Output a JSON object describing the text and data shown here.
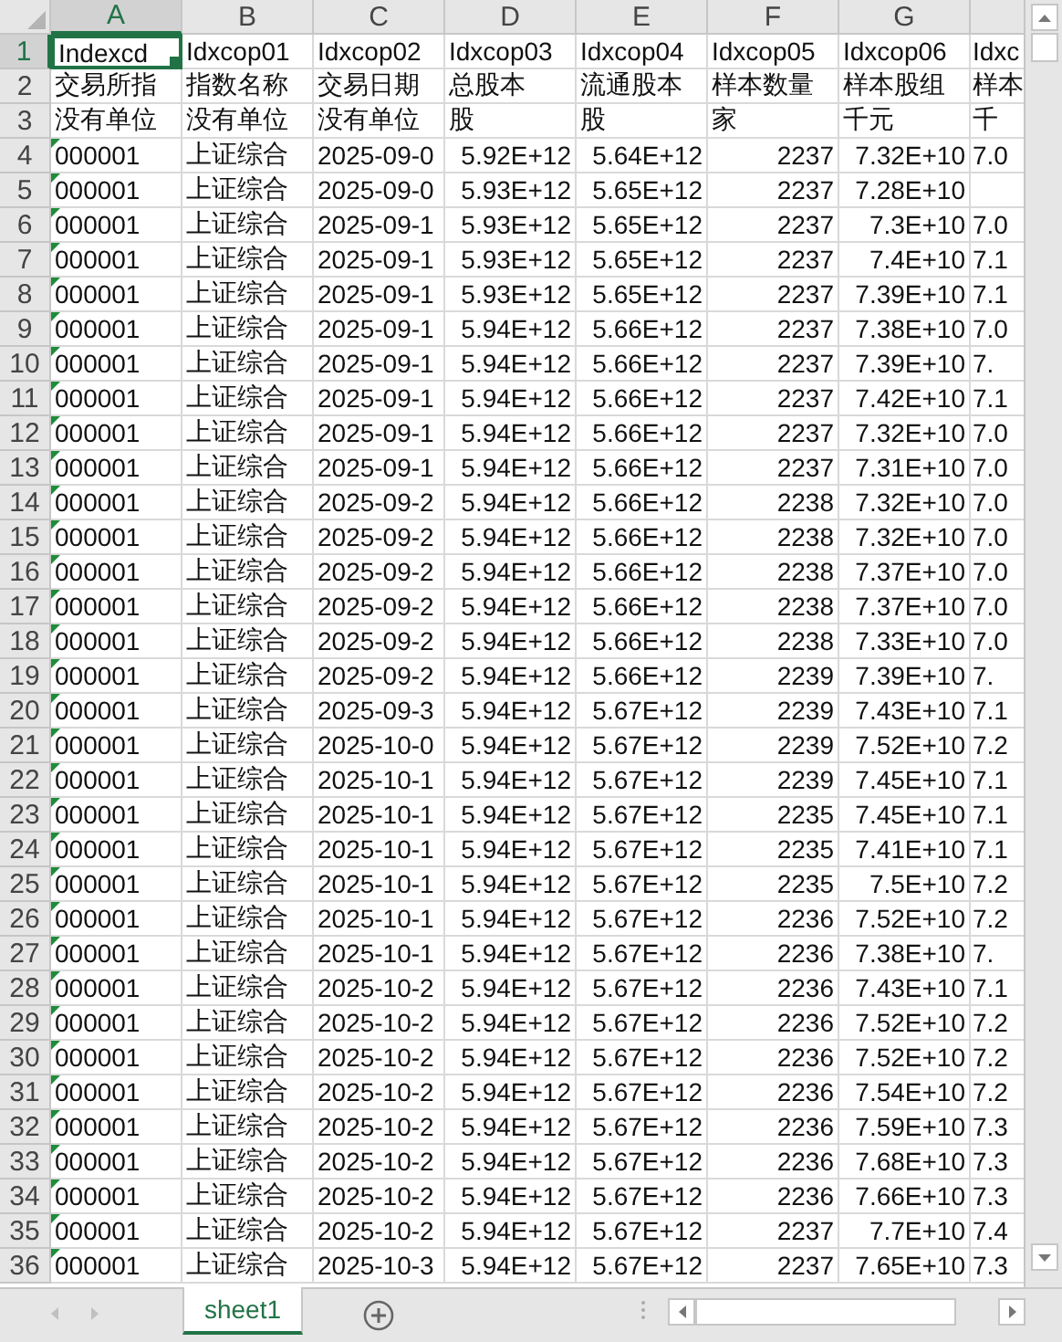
{
  "columns": [
    {
      "letter": "A",
      "kind": "code",
      "selected": true
    },
    {
      "letter": "B",
      "kind": "text",
      "selected": false
    },
    {
      "letter": "C",
      "kind": "text",
      "selected": false
    },
    {
      "letter": "D",
      "kind": "number",
      "selected": false
    },
    {
      "letter": "E",
      "kind": "number",
      "selected": false
    },
    {
      "letter": "F",
      "kind": "number",
      "selected": false
    },
    {
      "letter": "G",
      "kind": "number",
      "selected": false
    },
    {
      "kind": "partial",
      "selected": false
    }
  ],
  "rows": [
    {
      "number": "1",
      "kind": "header",
      "selected": true,
      "cells": [
        "Indexcd",
        "Idxcop01",
        "Idxcop02",
        "Idxcop03",
        "Idxcop04",
        "Idxcop05",
        "Idxcop06",
        "Idxc"
      ]
    },
    {
      "number": "2",
      "kind": "header",
      "selected": false,
      "cells": [
        "交易所指",
        "指数名称",
        "交易日期",
        "总股本",
        "流通股本",
        "样本数量",
        "样本股组",
        "样本"
      ]
    },
    {
      "number": "3",
      "kind": "header",
      "selected": false,
      "cells": [
        "没有单位",
        "没有单位",
        "没有单位",
        "股",
        "股",
        "家",
        "千元",
        "千"
      ]
    },
    {
      "number": "4",
      "kind": "data",
      "selected": false,
      "cells": [
        "000001",
        "上证综合",
        "2025-09-0",
        "5.92E+12",
        "5.64E+12",
        "2237",
        "7.32E+10",
        "7.0"
      ]
    },
    {
      "number": "5",
      "kind": "data",
      "selected": false,
      "cells": [
        "000001",
        "上证综合",
        "2025-09-0",
        "5.93E+12",
        "5.65E+12",
        "2237",
        "7.28E+10",
        null
      ]
    },
    {
      "number": "6",
      "kind": "data",
      "selected": false,
      "cells": [
        "000001",
        "上证综合",
        "2025-09-1",
        "5.93E+12",
        "5.65E+12",
        "2237",
        "7.3E+10",
        "7.0"
      ]
    },
    {
      "number": "7",
      "kind": "data",
      "selected": false,
      "cells": [
        "000001",
        "上证综合",
        "2025-09-1",
        "5.93E+12",
        "5.65E+12",
        "2237",
        "7.4E+10",
        "7.1"
      ]
    },
    {
      "number": "8",
      "kind": "data",
      "selected": false,
      "cells": [
        "000001",
        "上证综合",
        "2025-09-1",
        "5.93E+12",
        "5.65E+12",
        "2237",
        "7.39E+10",
        "7.1"
      ]
    },
    {
      "number": "9",
      "kind": "data",
      "selected": false,
      "cells": [
        "000001",
        "上证综合",
        "2025-09-1",
        "5.94E+12",
        "5.66E+12",
        "2237",
        "7.38E+10",
        "7.0"
      ]
    },
    {
      "number": "10",
      "kind": "data",
      "selected": false,
      "cells": [
        "000001",
        "上证综合",
        "2025-09-1",
        "5.94E+12",
        "5.66E+12",
        "2237",
        "7.39E+10",
        "7."
      ]
    },
    {
      "number": "11",
      "kind": "data",
      "selected": false,
      "cells": [
        "000001",
        "上证综合",
        "2025-09-1",
        "5.94E+12",
        "5.66E+12",
        "2237",
        "7.42E+10",
        "7.1"
      ]
    },
    {
      "number": "12",
      "kind": "data",
      "selected": false,
      "cells": [
        "000001",
        "上证综合",
        "2025-09-1",
        "5.94E+12",
        "5.66E+12",
        "2237",
        "7.32E+10",
        "7.0"
      ]
    },
    {
      "number": "13",
      "kind": "data",
      "selected": false,
      "cells": [
        "000001",
        "上证综合",
        "2025-09-1",
        "5.94E+12",
        "5.66E+12",
        "2237",
        "7.31E+10",
        "7.0"
      ]
    },
    {
      "number": "14",
      "kind": "data",
      "selected": false,
      "cells": [
        "000001",
        "上证综合",
        "2025-09-2",
        "5.94E+12",
        "5.66E+12",
        "2238",
        "7.32E+10",
        "7.0"
      ]
    },
    {
      "number": "15",
      "kind": "data",
      "selected": false,
      "cells": [
        "000001",
        "上证综合",
        "2025-09-2",
        "5.94E+12",
        "5.66E+12",
        "2238",
        "7.32E+10",
        "7.0"
      ]
    },
    {
      "number": "16",
      "kind": "data",
      "selected": false,
      "cells": [
        "000001",
        "上证综合",
        "2025-09-2",
        "5.94E+12",
        "5.66E+12",
        "2238",
        "7.37E+10",
        "7.0"
      ]
    },
    {
      "number": "17",
      "kind": "data",
      "selected": false,
      "cells": [
        "000001",
        "上证综合",
        "2025-09-2",
        "5.94E+12",
        "5.66E+12",
        "2238",
        "7.37E+10",
        "7.0"
      ]
    },
    {
      "number": "18",
      "kind": "data",
      "selected": false,
      "cells": [
        "000001",
        "上证综合",
        "2025-09-2",
        "5.94E+12",
        "5.66E+12",
        "2238",
        "7.33E+10",
        "7.0"
      ]
    },
    {
      "number": "19",
      "kind": "data",
      "selected": false,
      "cells": [
        "000001",
        "上证综合",
        "2025-09-2",
        "5.94E+12",
        "5.66E+12",
        "2239",
        "7.39E+10",
        "7."
      ]
    },
    {
      "number": "20",
      "kind": "data",
      "selected": false,
      "cells": [
        "000001",
        "上证综合",
        "2025-09-3",
        "5.94E+12",
        "5.67E+12",
        "2239",
        "7.43E+10",
        "7.1"
      ]
    },
    {
      "number": "21",
      "kind": "data",
      "selected": false,
      "cells": [
        "000001",
        "上证综合",
        "2025-10-0",
        "5.94E+12",
        "5.67E+12",
        "2239",
        "7.52E+10",
        "7.2"
      ]
    },
    {
      "number": "22",
      "kind": "data",
      "selected": false,
      "cells": [
        "000001",
        "上证综合",
        "2025-10-1",
        "5.94E+12",
        "5.67E+12",
        "2239",
        "7.45E+10",
        "7.1"
      ]
    },
    {
      "number": "23",
      "kind": "data",
      "selected": false,
      "cells": [
        "000001",
        "上证综合",
        "2025-10-1",
        "5.94E+12",
        "5.67E+12",
        "2235",
        "7.45E+10",
        "7.1"
      ]
    },
    {
      "number": "24",
      "kind": "data",
      "selected": false,
      "cells": [
        "000001",
        "上证综合",
        "2025-10-1",
        "5.94E+12",
        "5.67E+12",
        "2235",
        "7.41E+10",
        "7.1"
      ]
    },
    {
      "number": "25",
      "kind": "data",
      "selected": false,
      "cells": [
        "000001",
        "上证综合",
        "2025-10-1",
        "5.94E+12",
        "5.67E+12",
        "2235",
        "7.5E+10",
        "7.2"
      ]
    },
    {
      "number": "26",
      "kind": "data",
      "selected": false,
      "cells": [
        "000001",
        "上证综合",
        "2025-10-1",
        "5.94E+12",
        "5.67E+12",
        "2236",
        "7.52E+10",
        "7.2"
      ]
    },
    {
      "number": "27",
      "kind": "data",
      "selected": false,
      "cells": [
        "000001",
        "上证综合",
        "2025-10-1",
        "5.94E+12",
        "5.67E+12",
        "2236",
        "7.38E+10",
        "7."
      ]
    },
    {
      "number": "28",
      "kind": "data",
      "selected": false,
      "cells": [
        "000001",
        "上证综合",
        "2025-10-2",
        "5.94E+12",
        "5.67E+12",
        "2236",
        "7.43E+10",
        "7.1"
      ]
    },
    {
      "number": "29",
      "kind": "data",
      "selected": false,
      "cells": [
        "000001",
        "上证综合",
        "2025-10-2",
        "5.94E+12",
        "5.67E+12",
        "2236",
        "7.52E+10",
        "7.2"
      ]
    },
    {
      "number": "30",
      "kind": "data",
      "selected": false,
      "cells": [
        "000001",
        "上证综合",
        "2025-10-2",
        "5.94E+12",
        "5.67E+12",
        "2236",
        "7.52E+10",
        "7.2"
      ]
    },
    {
      "number": "31",
      "kind": "data",
      "selected": false,
      "cells": [
        "000001",
        "上证综合",
        "2025-10-2",
        "5.94E+12",
        "5.67E+12",
        "2236",
        "7.54E+10",
        "7.2"
      ]
    },
    {
      "number": "32",
      "kind": "data",
      "selected": false,
      "cells": [
        "000001",
        "上证综合",
        "2025-10-2",
        "5.94E+12",
        "5.67E+12",
        "2236",
        "7.59E+10",
        "7.3"
      ]
    },
    {
      "number": "33",
      "kind": "data",
      "selected": false,
      "cells": [
        "000001",
        "上证综合",
        "2025-10-2",
        "5.94E+12",
        "5.67E+12",
        "2236",
        "7.68E+10",
        "7.3"
      ]
    },
    {
      "number": "34",
      "kind": "data",
      "selected": false,
      "cells": [
        "000001",
        "上证综合",
        "2025-10-2",
        "5.94E+12",
        "5.67E+12",
        "2236",
        "7.66E+10",
        "7.3"
      ]
    },
    {
      "number": "35",
      "kind": "data",
      "selected": false,
      "cells": [
        "000001",
        "上证综合",
        "2025-10-2",
        "5.94E+12",
        "5.67E+12",
        "2237",
        "7.7E+10",
        "7.4"
      ]
    },
    {
      "number": "36",
      "kind": "data",
      "selected": false,
      "cells": [
        "000001",
        "上证综合",
        "2025-10-3",
        "5.94E+12",
        "5.67E+12",
        "2237",
        "7.65E+10",
        "7.3"
      ]
    }
  ],
  "sheet_tabs": [
    {
      "label": "sheet1",
      "selected": true
    }
  ]
}
